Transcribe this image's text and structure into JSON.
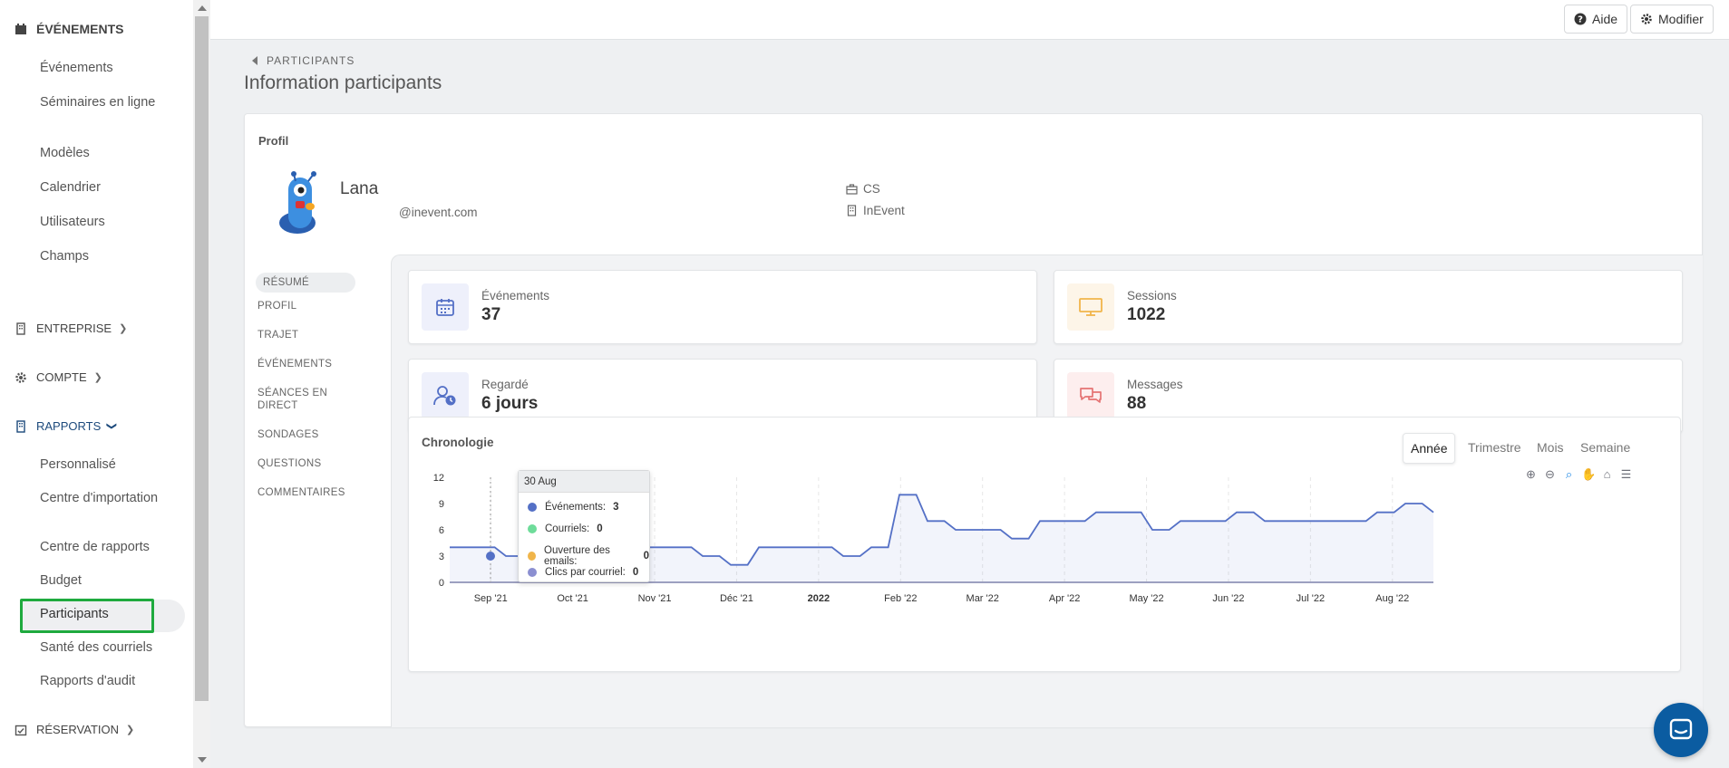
{
  "sidebar": {
    "sections": [
      {
        "label": "ÉVÉNEMENTS",
        "icon": "calendar-icon"
      },
      {
        "label": "ENTREPRISE",
        "icon": "building-icon"
      },
      {
        "label": "COMPTE",
        "icon": "gear-icon"
      },
      {
        "label": "RAPPORTS",
        "icon": "building-icon"
      },
      {
        "label": "RÉSERVATION",
        "icon": "calendar-check-icon"
      }
    ],
    "events_items": [
      "Événements",
      "Séminaires en ligne",
      "Modèles",
      "Calendrier",
      "Utilisateurs",
      "Champs"
    ],
    "reports_items": [
      "Personnalisé",
      "Centre d'importation",
      "Centre de rapports",
      "Budget",
      "Participants",
      "Santé des courriels",
      "Rapports d'audit"
    ],
    "selected_item": "Participants"
  },
  "topbar": {
    "help_label": "Aide",
    "edit_label": "Modifier"
  },
  "header": {
    "breadcrumb": "PARTICIPANTS",
    "title": "Information participants"
  },
  "profile": {
    "section_label": "Profil",
    "name": "Lana",
    "email": "@inevent.com",
    "role": "CS",
    "company": "InEvent"
  },
  "tabs": [
    "RÉSUMÉ",
    "PROFIL",
    "TRAJET",
    "ÉVÉNEMENTS",
    "SÉANCES EN DIRECT",
    "SONDAGES",
    "QUESTIONS",
    "COMMENTAIRES"
  ],
  "stats": {
    "events": {
      "label": "Événements",
      "value": "37"
    },
    "sessions": {
      "label": "Sessions",
      "value": "1022"
    },
    "watched": {
      "label": "Regardé",
      "value": "6 jours"
    },
    "messages": {
      "label": "Messages",
      "value": "88"
    }
  },
  "timeline": {
    "title": "Chronologie",
    "periods": [
      "Année",
      "Trimestre",
      "Mois",
      "Semaine"
    ],
    "active_period": "Année"
  },
  "colors": {
    "events": "#5470c6",
    "emails": "#6edc9a",
    "opens": "#f0b54a",
    "clicks": "#8b8fd1",
    "selected_outline": "#1faa3e",
    "chat": "#0b5ca1"
  },
  "chart_data": {
    "type": "line",
    "x_labels": [
      "Sep '21",
      "Oct '21",
      "Nov '21",
      "Déc '21",
      "2022",
      "Feb '22",
      "Mar '22",
      "Apr '22",
      "May '22",
      "Jun '22",
      "Jul '22",
      "Aug '22"
    ],
    "y_ticks": [
      0,
      3,
      6,
      9,
      12
    ],
    "ylim": [
      0,
      12
    ],
    "series": [
      {
        "name": "Événements",
        "color": "#5470c6",
        "values": [
          4,
          4,
          3,
          4,
          4,
          4,
          3,
          4,
          4,
          3,
          2,
          4,
          4,
          4,
          3,
          4,
          10,
          7,
          6,
          6,
          5,
          7,
          7,
          8,
          8,
          6,
          7,
          7,
          8,
          7,
          7,
          7,
          7,
          8,
          9,
          8
        ]
      },
      {
        "name": "Courriels",
        "color": "#6edc9a",
        "values": [
          0,
          0,
          0,
          0,
          0,
          0,
          0,
          0,
          0,
          0,
          0,
          0,
          0,
          0,
          0,
          0,
          0,
          0,
          0,
          0,
          0,
          0,
          0,
          0,
          0,
          0,
          0,
          0,
          0,
          0,
          0,
          0,
          0,
          0,
          0,
          0
        ]
      },
      {
        "name": "Ouverture des emails",
        "color": "#f0b54a",
        "values": [
          0,
          0,
          0,
          0,
          0,
          0,
          0,
          0,
          0,
          0,
          0,
          0,
          0,
          0,
          0,
          0,
          0,
          0,
          0,
          0,
          0,
          0,
          0,
          0,
          0,
          0,
          0,
          0,
          0,
          0,
          0,
          0,
          0,
          0,
          0,
          0
        ]
      },
      {
        "name": "Clics par courriel",
        "color": "#8b8fd1",
        "values": [
          0,
          0,
          0,
          0,
          0,
          0,
          0,
          0,
          0,
          0,
          0,
          0,
          0,
          0,
          0,
          0,
          0,
          0,
          0,
          0,
          0,
          0,
          0,
          0,
          0,
          0,
          0,
          0,
          0,
          0,
          0,
          0,
          0,
          0,
          0,
          0
        ]
      }
    ],
    "tooltip": {
      "date": "30 Aug",
      "rows": [
        {
          "name": "Événements:",
          "value": "3"
        },
        {
          "name": "Courriels:",
          "value": "0"
        },
        {
          "name": "Ouverture des emails:",
          "value": "0"
        },
        {
          "name": "Clics par courriel:",
          "value": "0"
        }
      ]
    }
  }
}
